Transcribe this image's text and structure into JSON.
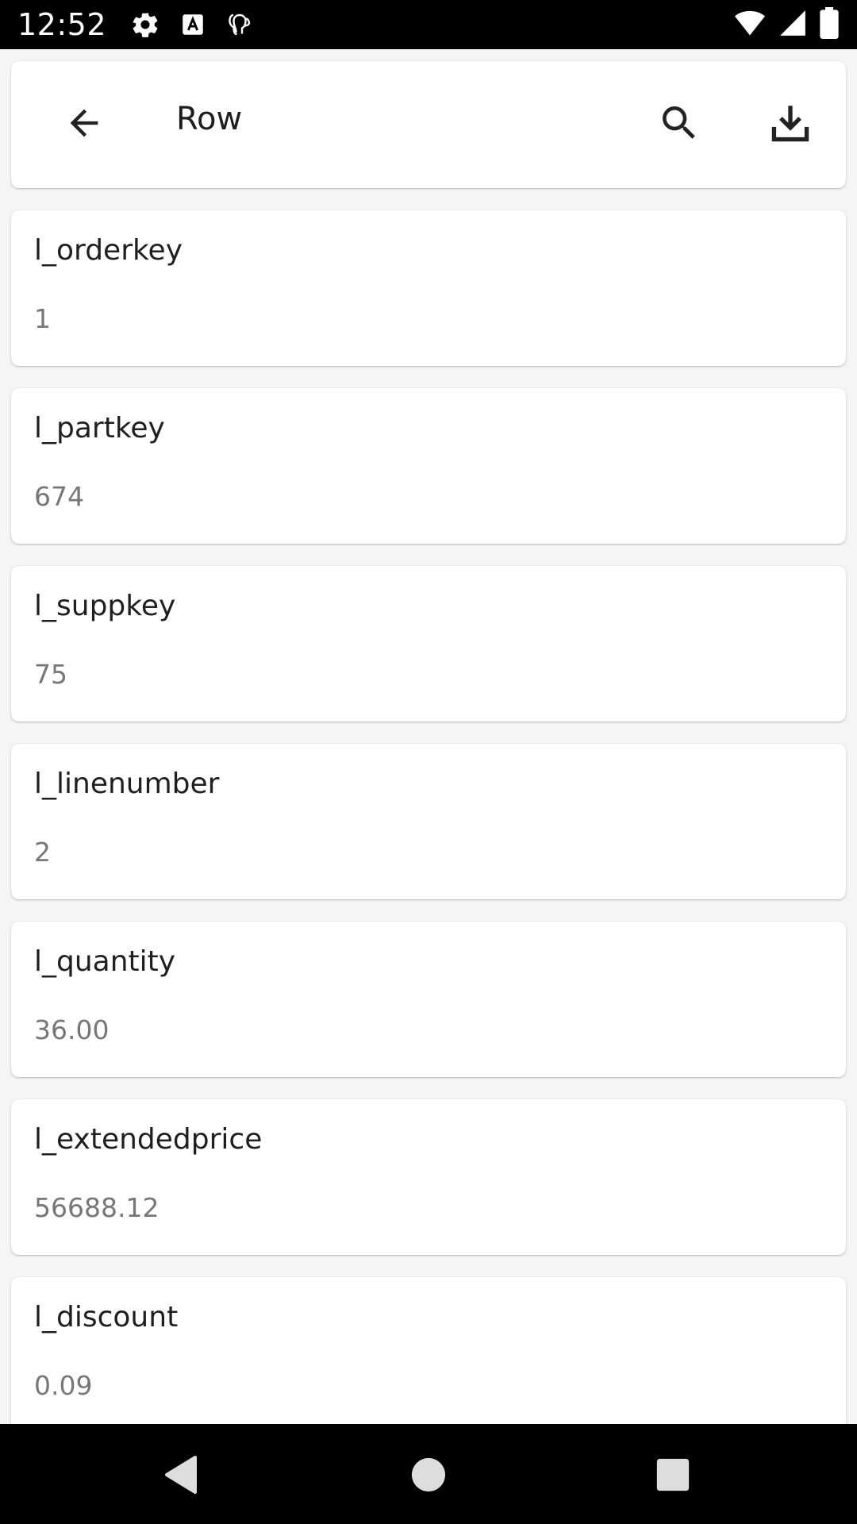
{
  "status_bar": {
    "time": "12:52",
    "left_icons": [
      "settings-icon",
      "text-a-icon",
      "database-icon"
    ],
    "right_icons": [
      "wifi-icon",
      "cellular-icon",
      "battery-icon"
    ]
  },
  "app_bar": {
    "title": "Row",
    "back_icon": "arrow-back-icon",
    "search_icon": "search-icon",
    "download_icon": "download-icon"
  },
  "fields": [
    {
      "name": "l_orderkey",
      "value": "1"
    },
    {
      "name": "l_partkey",
      "value": "674"
    },
    {
      "name": "l_suppkey",
      "value": "75"
    },
    {
      "name": "l_linenumber",
      "value": "2"
    },
    {
      "name": "l_quantity",
      "value": "36.00"
    },
    {
      "name": "l_extendedprice",
      "value": "56688.12"
    },
    {
      "name": "l_discount",
      "value": "0.09"
    }
  ],
  "nav_bar": {
    "icons": [
      "nav-back-icon",
      "nav-home-icon",
      "nav-recents-icon"
    ]
  },
  "colors": {
    "background": "#f5f5f5",
    "card": "#ffffff",
    "field_value": "#777777",
    "system_bars": "#000000"
  }
}
